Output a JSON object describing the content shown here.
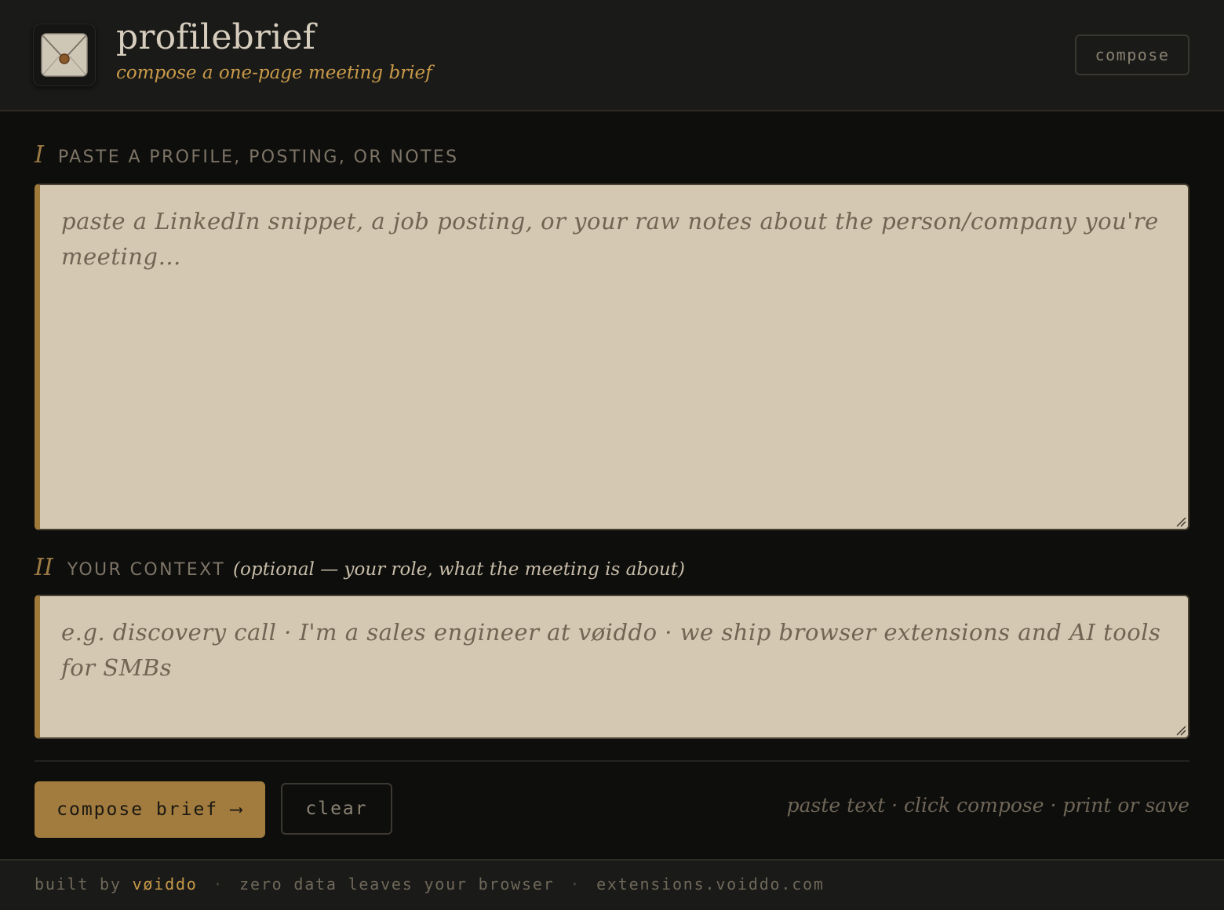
{
  "header": {
    "title": "profilebrief",
    "subtitle": "compose a one-page meeting brief",
    "compose_button": "compose",
    "logo_icon": "envelope-icon"
  },
  "section1": {
    "numeral": "I",
    "label": "PASTE A PROFILE, POSTING, OR NOTES",
    "placeholder": "paste a LinkedIn snippet, a job posting, or your raw notes about the person/company you're meeting…"
  },
  "section2": {
    "numeral": "II",
    "label": "YOUR CONTEXT",
    "hint": "(optional — your role, what the meeting is about)",
    "placeholder": "e.g. discovery call · I'm a sales engineer at vøiddo · we ship browser extensions and AI tools for SMBs"
  },
  "actions": {
    "compose_brief": "compose brief ⟶",
    "clear": "clear",
    "hint": "paste text · click compose · print or save"
  },
  "footer": {
    "built_by": "built by",
    "brand": "vøiddo",
    "separator": "·",
    "privacy": "zero data leaves your browser",
    "site": "extensions.voiddo.com"
  },
  "colors": {
    "accent": "#a27c3e",
    "accent_text": "#c99a48",
    "background": "#0e0e0d",
    "panel": "#1a1a19",
    "field": "#d4c8b2"
  }
}
